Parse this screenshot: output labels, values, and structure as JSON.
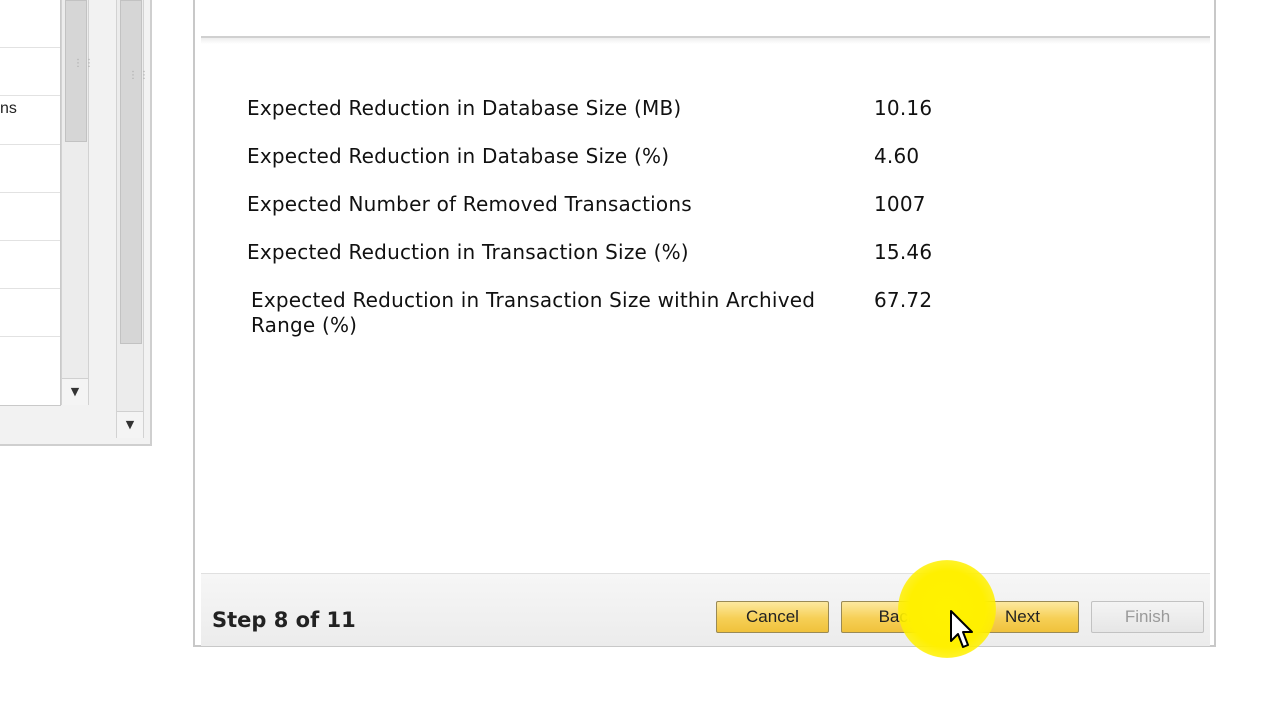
{
  "background_panel": {
    "list_items": [
      "",
      "",
      "ns",
      "",
      "",
      "",
      "",
      ""
    ]
  },
  "metrics": [
    {
      "label": "Expected Reduction in Database Size (MB)",
      "value": "10.16"
    },
    {
      "label": "Expected Reduction in Database Size (%)",
      "value": "4.60"
    },
    {
      "label": "Expected Number of Removed Transactions",
      "value": "1007"
    },
    {
      "label": "Expected Reduction in Transaction Size (%)",
      "value": "15.46"
    },
    {
      "label": "Expected Reduction in Transaction Size within Archived Range (%)",
      "value": "67.72"
    }
  ],
  "footer": {
    "step_text": "Step 8 of 11",
    "buttons": {
      "cancel": "Cancel",
      "back": "Back",
      "next": "Next",
      "finish": "Finish"
    },
    "finish_enabled": false
  },
  "colors": {
    "button_accent": "#f6cf55",
    "cursor_highlight": "#fff200"
  },
  "icons": {
    "scroll_down": "chevron-down-icon",
    "cursor": "mouse-pointer-icon"
  }
}
